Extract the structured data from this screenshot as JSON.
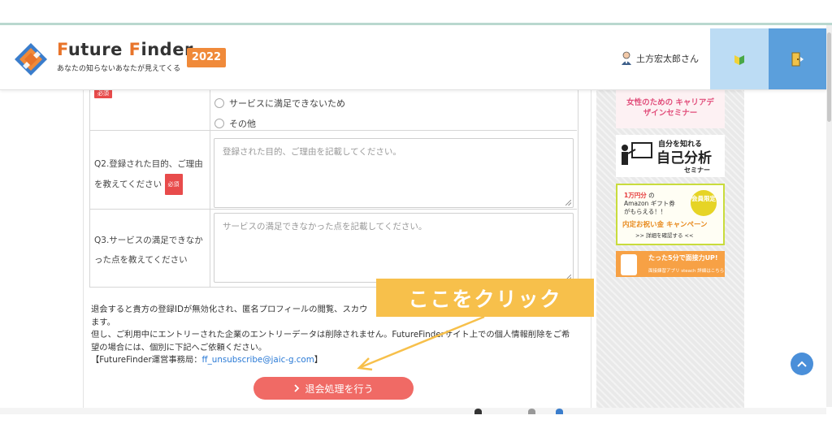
{
  "header": {
    "logo_title_first": "F",
    "logo_title_rest": "uture ",
    "logo_title_f2": "F",
    "logo_title_rest2": "inder",
    "logo_subtitle": "あなたの知らないあなたが見えてくる",
    "year_badge": "2022",
    "user_name": "土方宏太郎さん",
    "beginner_icon": "beginner-leaf-icon",
    "logout_icon": "logout-door-icon"
  },
  "form": {
    "required_label": "必須",
    "options": [
      {
        "label": "サービスに満足できないため"
      },
      {
        "label": "その他"
      }
    ],
    "q2": {
      "label": "Q2.登録された目的、ご理由を教えてください",
      "placeholder": "登録された目的、ご理由を記載してください。"
    },
    "q3": {
      "label": "Q3.サービスの満足できなかった点を教えてください",
      "placeholder": "サービスの満足できなかった点を記載してください。"
    }
  },
  "notice": {
    "line1": "退会すると貴方の登録IDが無効化され、匿名プロフィールの閲覧、スカウ",
    "line2": "ます。",
    "line3": "但し、ご利用中にエントリーされた企業のエントリーデータは削除されません。FutureFinderサイト上での個人情報削除をご希",
    "line4": "望の場合には、個別に下記へご依頼ください。",
    "contact_prefix": "【FutureFinder運営事務局：",
    "contact_email": "ff_unsubscribe@jaic-g.com",
    "contact_suffix": "】"
  },
  "unsubscribe_button": {
    "label": "退会処理を行う",
    "icon": "chevron-right-icon"
  },
  "callout": {
    "text": "ここをクリック"
  },
  "sidebar": {
    "banner1": "女性のための キャリアデザインセミナー",
    "banner2": {
      "small": "自分を知れる",
      "big": "自己分析",
      "sub": "セミナー"
    },
    "banner3": {
      "amount": "1万円分",
      "line1_rest": "の",
      "line2": "Amazon ギフト券",
      "line3": "がもらえる！！",
      "badge": "会員限定",
      "campaign": "内定お祝い金 キャンペーン",
      "details": ">> 詳細を確認する <<"
    },
    "banner4": {
      "title": "たった5分で面接力UP!",
      "sub": "面接練習アプリ steach 詳細はこちら"
    }
  },
  "colors": {
    "accent_orange": "#f08a3a",
    "header_blue": "#5b9fdc",
    "header_light_blue": "#bcdcf4",
    "unsubscribe_red": "#f06a65",
    "callout_yellow": "#f7c04b",
    "required_red": "#e84b4b"
  }
}
